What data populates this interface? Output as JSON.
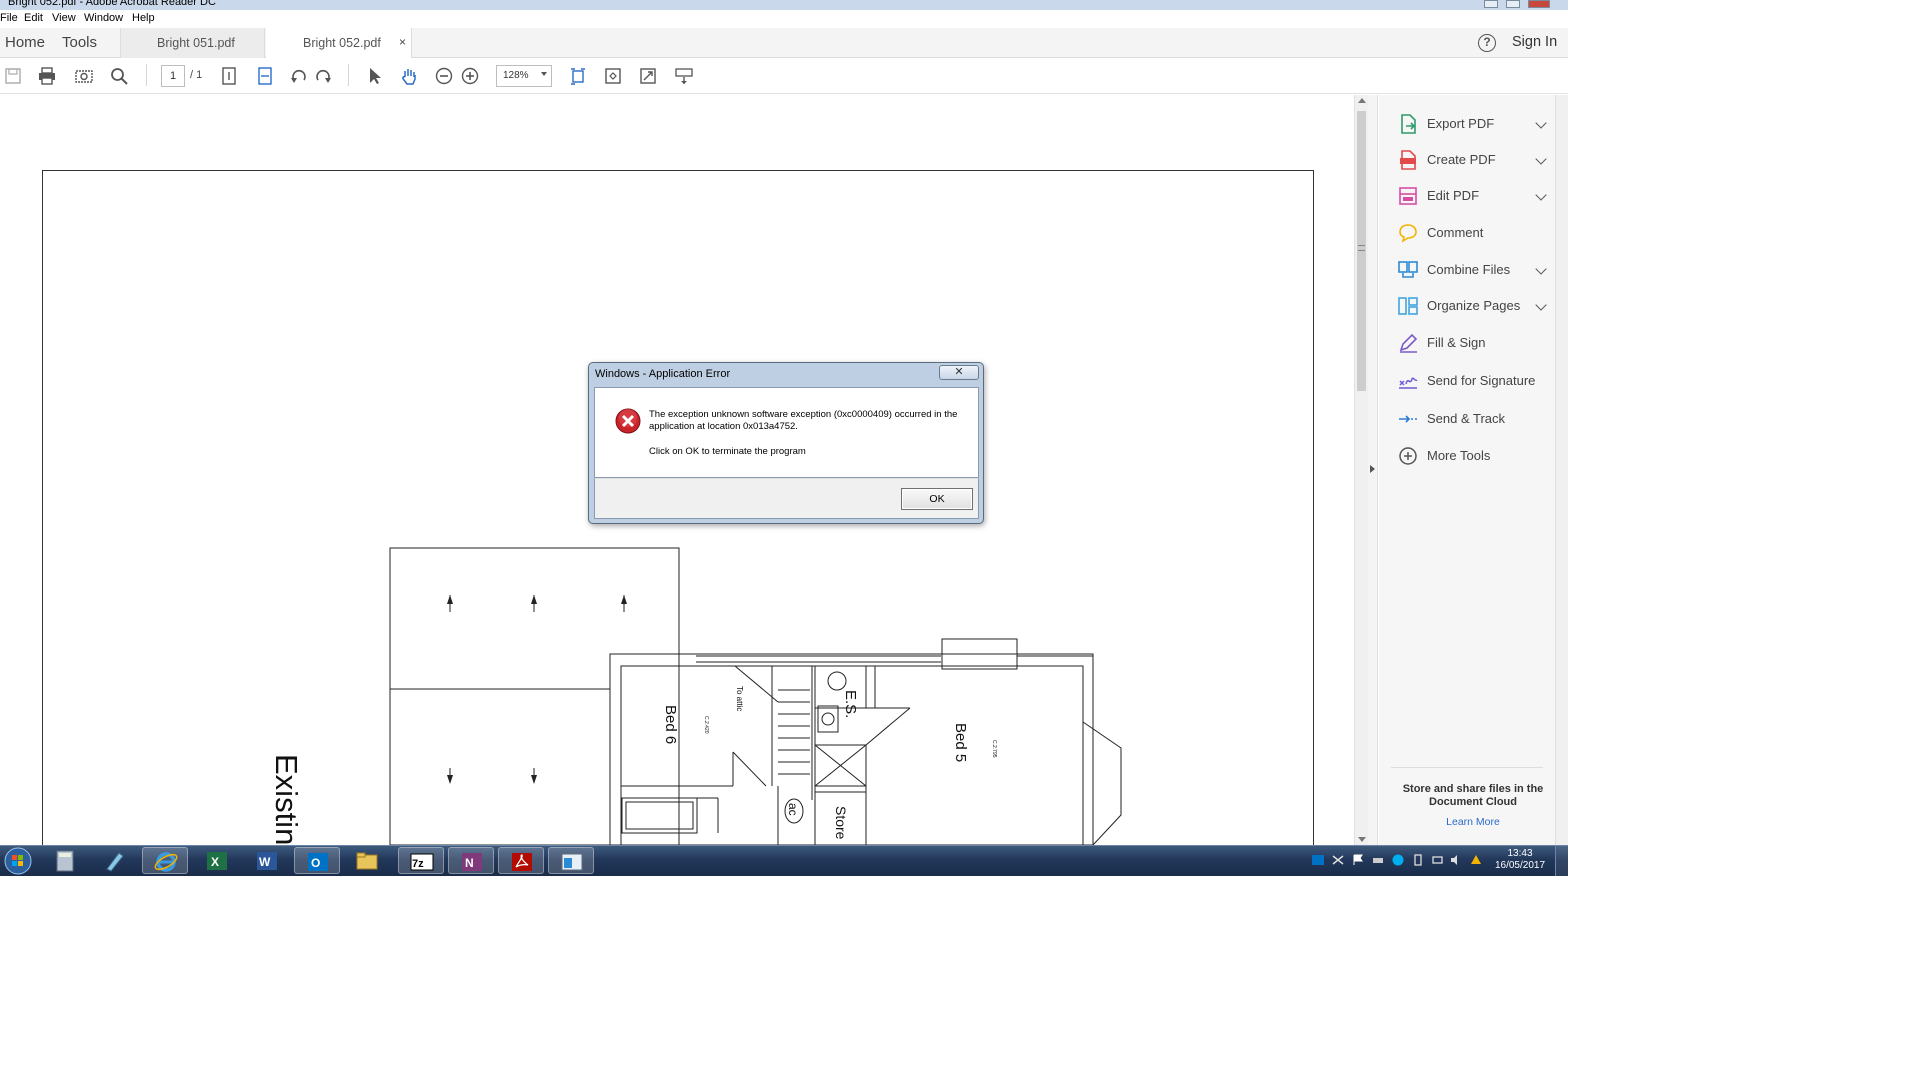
{
  "window": {
    "title": "Bright 052.pdf - Adobe Acrobat Reader DC"
  },
  "menu": [
    "File",
    "Edit",
    "View",
    "Window",
    "Help"
  ],
  "nav": {
    "home": "Home",
    "tools": "Tools"
  },
  "tabs": [
    {
      "label": "Bright 051.pdf",
      "active": false
    },
    {
      "label": "Bright 052.pdf",
      "active": true,
      "close": "×"
    }
  ],
  "header": {
    "help": "?",
    "sign_in": "Sign In"
  },
  "toolbar": {
    "page_current": "1",
    "page_total": "/ 1",
    "zoom": "128%",
    "icons": [
      "save-icon",
      "print-icon",
      "screenshot-icon",
      "search-icon",
      "page-fit-icon",
      "fit-width-icon",
      "rotate-ccw-icon",
      "rotate-cw-icon",
      "select-pointer-icon",
      "hand-icon",
      "zoom-out-icon",
      "zoom-in-icon",
      "read-mode-icon",
      "fit-page-icon",
      "full-screen-icon",
      "keyboard-scroll-icon"
    ]
  },
  "drawing": {
    "rooms": [
      "Bed 6",
      "Bed 5",
      "E.S.",
      "Store",
      "ac",
      "To attic"
    ],
    "dims": [
      "C.2.420",
      "C.2.795"
    ],
    "caption": "Existin"
  },
  "right_pane": {
    "tools": [
      {
        "label": "Export PDF",
        "icon": "export-pdf-icon",
        "color": "#2f9b6b",
        "dropdown": true
      },
      {
        "label": "Create PDF",
        "icon": "create-pdf-icon",
        "color": "#e24b4b",
        "dropdown": true
      },
      {
        "label": "Edit PDF",
        "icon": "edit-pdf-icon",
        "color": "#d84ca6",
        "dropdown": true
      },
      {
        "label": "Comment",
        "icon": "comment-icon",
        "color": "#f2b400",
        "dropdown": false
      },
      {
        "label": "Combine Files",
        "icon": "combine-files-icon",
        "color": "#2b8ad6",
        "dropdown": true
      },
      {
        "label": "Organize Pages",
        "icon": "organize-pages-icon",
        "color": "#41a5e0",
        "dropdown": true
      },
      {
        "label": "Fill & Sign",
        "icon": "fill-sign-icon",
        "color": "#7b5ac8",
        "dropdown": false
      },
      {
        "label": "Send for Signature",
        "icon": "send-signature-icon",
        "color": "#6a5ad6",
        "dropdown": false
      },
      {
        "label": "Send & Track",
        "icon": "send-track-icon",
        "color": "#2b7bd6",
        "dropdown": false
      },
      {
        "label": "More Tools",
        "icon": "more-tools-icon",
        "color": "#555555",
        "dropdown": false
      }
    ],
    "cloud_text": "Store and share files in the Document Cloud",
    "learn_more": "Learn More"
  },
  "dialog": {
    "title": "Windows - Application Error",
    "close": "✕",
    "message": "The exception unknown software exception (0xc0000409) occurred in the application at location 0x013a4752.",
    "message2": "Click on OK to terminate the program",
    "ok": "OK"
  },
  "taskbar": {
    "apps": [
      "start-orb-icon",
      "calculator-icon",
      "stylus-icon",
      "internet-explorer-icon",
      "excel-icon",
      "word-icon",
      "outlook-icon",
      "file-explorer-icon",
      "7zip-icon",
      "onenote-icon",
      "acrobat-icon",
      "remote-app-icon"
    ],
    "clock_time": "13:43",
    "clock_date": "16/05/2017"
  }
}
